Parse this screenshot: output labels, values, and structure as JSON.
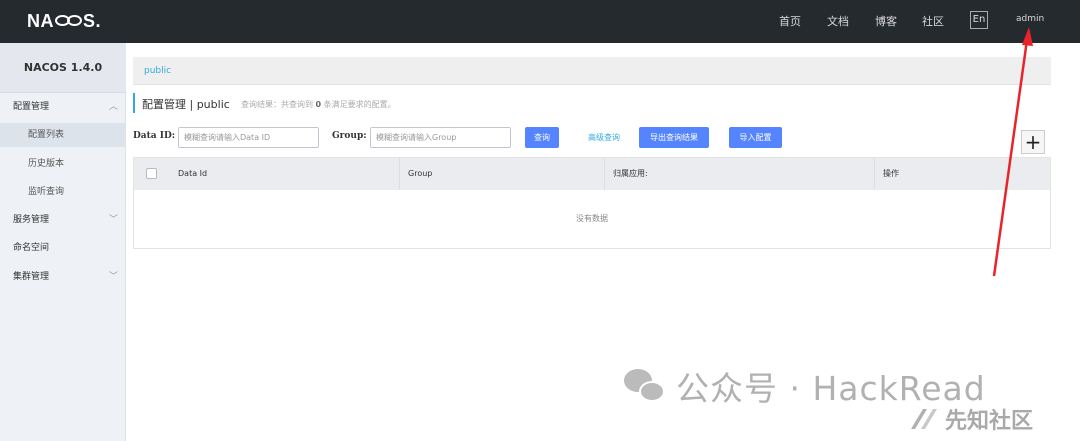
{
  "header": {
    "logo": "NACOS.",
    "nav": [
      "首页",
      "文档",
      "博客",
      "社区"
    ],
    "lang": "En",
    "user": "admin"
  },
  "sidebar": {
    "version": "NACOS 1.4.0",
    "items": [
      {
        "label": "配置管理",
        "type": "group",
        "expanded": true
      },
      {
        "label": "配置列表",
        "type": "sub",
        "active": true
      },
      {
        "label": "历史版本",
        "type": "sub"
      },
      {
        "label": "监听查询",
        "type": "sub"
      },
      {
        "label": "服务管理",
        "type": "group",
        "expanded": false
      },
      {
        "label": "命名空间",
        "type": "group"
      },
      {
        "label": "集群管理",
        "type": "group",
        "expanded": false
      }
    ]
  },
  "main": {
    "breadcrumb": "public",
    "title": "配置管理 | public",
    "query_result_prefix": "查询结果：共查询到",
    "query_result_count": "0",
    "query_result_suffix": "条满足要求的配置。",
    "filters": {
      "data_id_label": "Data ID:",
      "data_id_placeholder": "模糊查询请输入Data ID",
      "group_label": "Group:",
      "group_placeholder": "模糊查询请输入Group"
    },
    "buttons": {
      "query": "查询",
      "advanced_query": "高级查询",
      "export": "导出查询结果",
      "import": "导入配置",
      "add": "+"
    },
    "table": {
      "columns": [
        "Data Id",
        "Group",
        "归属应用:",
        "操作"
      ],
      "empty_text": "没有数据"
    }
  },
  "watermarks": {
    "wechat": "公众号 · HackRead",
    "xianzhi": "先知社区"
  },
  "colors": {
    "topbar": "#252a2f",
    "primary_button": "#5584ff",
    "link": "#33aadd",
    "annotation_arrow": "#e8232a"
  }
}
